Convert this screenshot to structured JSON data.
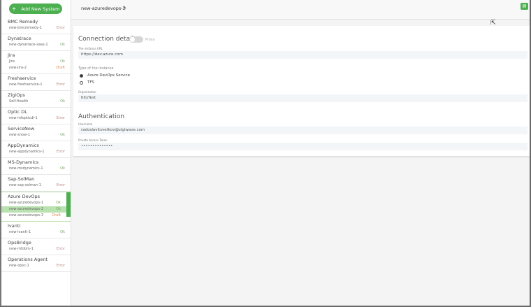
{
  "sidebar": {
    "add_button_label": "Add New System",
    "groups": [
      {
        "title": "BMC Remedy",
        "items": [
          {
            "name": "new-bmcremedy-1",
            "status": "Error"
          }
        ]
      },
      {
        "title": "Dynatrace",
        "items": [
          {
            "name": "new-dynatrace-saas-1",
            "status": "Ok"
          }
        ]
      },
      {
        "title": "Jira",
        "items": [
          {
            "name": "Jira",
            "status": "Ok"
          },
          {
            "name": "new-jira-2",
            "status": "Draft"
          }
        ]
      },
      {
        "title": "Freshservice",
        "items": [
          {
            "name": "new-freshservice-1",
            "status": "Error"
          }
        ]
      },
      {
        "title": "ZigiOps",
        "items": [
          {
            "name": "Self-Health",
            "status": "Ok"
          }
        ]
      },
      {
        "title": "Optic DL",
        "items": [
          {
            "name": "new-mfopticdl-1",
            "status": "Error"
          }
        ]
      },
      {
        "title": "ServiceNow",
        "items": [
          {
            "name": "new-snow-1",
            "status": "Ok"
          }
        ]
      },
      {
        "title": "AppDynamics",
        "items": [
          {
            "name": "new-appdynamics-1",
            "status": "Error"
          }
        ]
      },
      {
        "title": "MS-Dynamics",
        "items": [
          {
            "name": "new-msdynamics-1",
            "status": "Ok"
          }
        ]
      },
      {
        "title": "Sap-SolMan",
        "items": [
          {
            "name": "new-sap-solman-1",
            "status": "Error"
          }
        ]
      },
      {
        "title": "Azure DevOps",
        "items": [
          {
            "name": "new-azuredevops-1",
            "status": "Ok"
          },
          {
            "name": "new-azuredevops-2",
            "status": "Ok"
          },
          {
            "name": "new-azuredevops-3",
            "status": "Draft"
          }
        ]
      },
      {
        "title": "Ivanti",
        "items": [
          {
            "name": "new-ivanti-1",
            "status": "Ok"
          }
        ]
      },
      {
        "title": "OpsBridge",
        "items": [
          {
            "name": "new-mfobm-1",
            "status": "Error"
          }
        ]
      },
      {
        "title": "Operations Agent",
        "items": [
          {
            "name": "new-opsc-1",
            "status": "Error"
          }
        ]
      }
    ]
  },
  "topbar": {
    "title": "new-azuredevops-2"
  },
  "connection": {
    "title": "Connection details",
    "proxy_label": "Proxy",
    "instance_url_label": "The instance URL",
    "instance_url_value": "https://dev.azure.com",
    "type_label": "Type of the instance",
    "type_options": [
      "Azure DevOps Service",
      "TFS"
    ],
    "organization_label": "Organization",
    "organization_value": "KitsTest"
  },
  "authentication": {
    "title": "Authentication",
    "username_label": "Username",
    "username_value": "radoslavitsvetkov@zigiwave.com",
    "token_label": "Private Access Token",
    "token_value": "••••••••••••••"
  },
  "colors": {
    "accent": "#4caf50",
    "selected_row": "#b9e2b0"
  }
}
